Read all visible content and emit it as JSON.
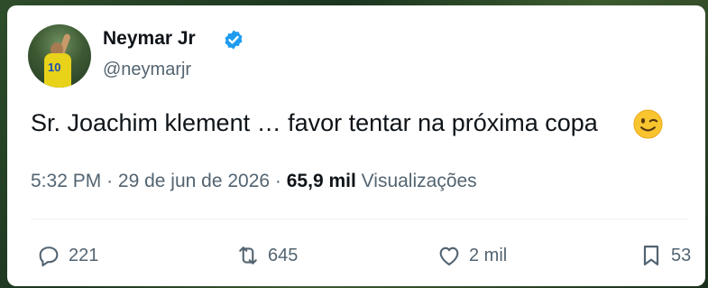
{
  "author": {
    "name": "Neymar Jr",
    "handle": "@neymarjr"
  },
  "tweet": {
    "text": "Sr. Joachim klement … favor tentar na próxima copa",
    "emoji": "winking-face"
  },
  "meta": {
    "time": "5:32 PM",
    "separator": "·",
    "date": "29 de jun de 2026",
    "views_count": "65,9 mil",
    "views_label": "Visualizações"
  },
  "actions": {
    "replies": "221",
    "reposts": "645",
    "likes": "2 mil",
    "bookmarks": "53"
  },
  "colors": {
    "verified": "#1d9bf0",
    "text": "#0f1419",
    "secondary": "#536471"
  }
}
